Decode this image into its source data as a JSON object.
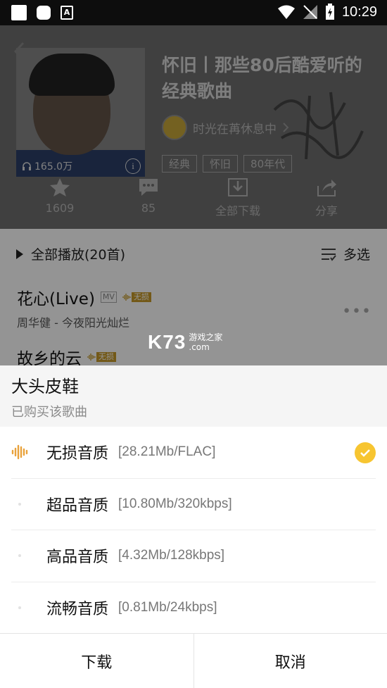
{
  "status_bar": {
    "time": "10:29"
  },
  "playlist": {
    "title": "怀旧丨那些80后酷爱听的经典歌曲",
    "creator": "时光在苒休息中",
    "play_count": "165.0万",
    "tags": [
      "经典",
      "怀旧",
      "80年代"
    ],
    "actions": [
      {
        "icon": "star-icon",
        "label": "1609"
      },
      {
        "icon": "comment-icon",
        "label": "85"
      },
      {
        "icon": "download-icon",
        "label": "全部下载"
      },
      {
        "icon": "share-icon",
        "label": "分享"
      }
    ]
  },
  "list": {
    "play_all": "全部播放(20首)",
    "multi_select": "多选",
    "songs": [
      {
        "title": "花心(Live)",
        "subtitle": "周华健 - 今夜阳光灿烂",
        "mv": "MV",
        "quality": "无损"
      },
      {
        "title": "故乡的云",
        "quality": "无损"
      }
    ]
  },
  "watermark": {
    "logo": "K73",
    "cn": "游戏之家",
    "domain": ".com"
  },
  "sheet": {
    "song": "大头皮鞋",
    "status": "已购买该歌曲",
    "options": [
      {
        "label": "无损音质",
        "detail": "[28.21Mb/FLAC]",
        "selected": true
      },
      {
        "label": "超品音质",
        "detail": "[10.80Mb/320kbps]",
        "selected": false
      },
      {
        "label": "高品音质",
        "detail": "[4.32Mb/128kbps]",
        "selected": false
      },
      {
        "label": "流畅音质",
        "detail": "[0.81Mb/24kbps]",
        "selected": false
      }
    ],
    "download_button": "下载",
    "cancel_button": "取消"
  },
  "colors": {
    "accent": "#f7c531",
    "lossless": "#c79a2a"
  }
}
